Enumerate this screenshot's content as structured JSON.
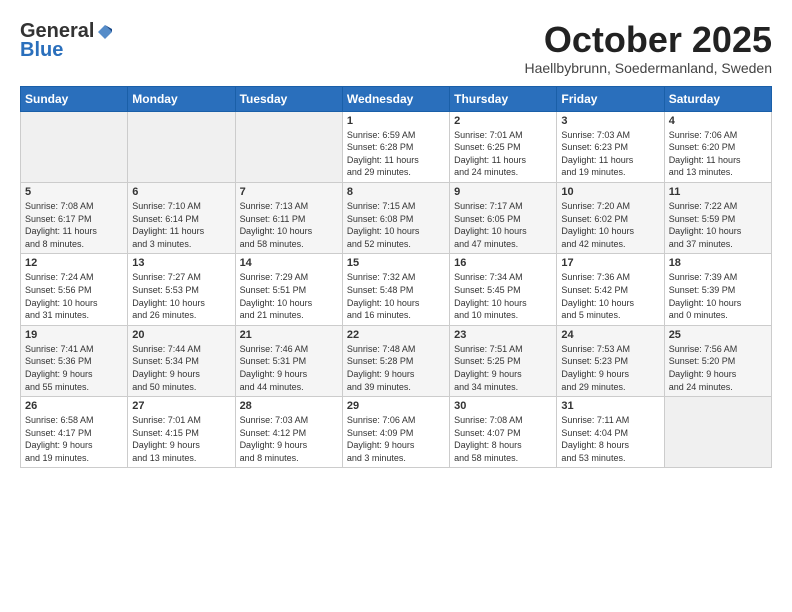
{
  "header": {
    "logo_line1": "General",
    "logo_line2": "Blue",
    "month": "October 2025",
    "location": "Haellbybrunn, Soedermanland, Sweden"
  },
  "days_of_week": [
    "Sunday",
    "Monday",
    "Tuesday",
    "Wednesday",
    "Thursday",
    "Friday",
    "Saturday"
  ],
  "weeks": [
    [
      {
        "day": "",
        "info": ""
      },
      {
        "day": "",
        "info": ""
      },
      {
        "day": "",
        "info": ""
      },
      {
        "day": "1",
        "info": "Sunrise: 6:59 AM\nSunset: 6:28 PM\nDaylight: 11 hours\nand 29 minutes."
      },
      {
        "day": "2",
        "info": "Sunrise: 7:01 AM\nSunset: 6:25 PM\nDaylight: 11 hours\nand 24 minutes."
      },
      {
        "day": "3",
        "info": "Sunrise: 7:03 AM\nSunset: 6:23 PM\nDaylight: 11 hours\nand 19 minutes."
      },
      {
        "day": "4",
        "info": "Sunrise: 7:06 AM\nSunset: 6:20 PM\nDaylight: 11 hours\nand 13 minutes."
      }
    ],
    [
      {
        "day": "5",
        "info": "Sunrise: 7:08 AM\nSunset: 6:17 PM\nDaylight: 11 hours\nand 8 minutes."
      },
      {
        "day": "6",
        "info": "Sunrise: 7:10 AM\nSunset: 6:14 PM\nDaylight: 11 hours\nand 3 minutes."
      },
      {
        "day": "7",
        "info": "Sunrise: 7:13 AM\nSunset: 6:11 PM\nDaylight: 10 hours\nand 58 minutes."
      },
      {
        "day": "8",
        "info": "Sunrise: 7:15 AM\nSunset: 6:08 PM\nDaylight: 10 hours\nand 52 minutes."
      },
      {
        "day": "9",
        "info": "Sunrise: 7:17 AM\nSunset: 6:05 PM\nDaylight: 10 hours\nand 47 minutes."
      },
      {
        "day": "10",
        "info": "Sunrise: 7:20 AM\nSunset: 6:02 PM\nDaylight: 10 hours\nand 42 minutes."
      },
      {
        "day": "11",
        "info": "Sunrise: 7:22 AM\nSunset: 5:59 PM\nDaylight: 10 hours\nand 37 minutes."
      }
    ],
    [
      {
        "day": "12",
        "info": "Sunrise: 7:24 AM\nSunset: 5:56 PM\nDaylight: 10 hours\nand 31 minutes."
      },
      {
        "day": "13",
        "info": "Sunrise: 7:27 AM\nSunset: 5:53 PM\nDaylight: 10 hours\nand 26 minutes."
      },
      {
        "day": "14",
        "info": "Sunrise: 7:29 AM\nSunset: 5:51 PM\nDaylight: 10 hours\nand 21 minutes."
      },
      {
        "day": "15",
        "info": "Sunrise: 7:32 AM\nSunset: 5:48 PM\nDaylight: 10 hours\nand 16 minutes."
      },
      {
        "day": "16",
        "info": "Sunrise: 7:34 AM\nSunset: 5:45 PM\nDaylight: 10 hours\nand 10 minutes."
      },
      {
        "day": "17",
        "info": "Sunrise: 7:36 AM\nSunset: 5:42 PM\nDaylight: 10 hours\nand 5 minutes."
      },
      {
        "day": "18",
        "info": "Sunrise: 7:39 AM\nSunset: 5:39 PM\nDaylight: 10 hours\nand 0 minutes."
      }
    ],
    [
      {
        "day": "19",
        "info": "Sunrise: 7:41 AM\nSunset: 5:36 PM\nDaylight: 9 hours\nand 55 minutes."
      },
      {
        "day": "20",
        "info": "Sunrise: 7:44 AM\nSunset: 5:34 PM\nDaylight: 9 hours\nand 50 minutes."
      },
      {
        "day": "21",
        "info": "Sunrise: 7:46 AM\nSunset: 5:31 PM\nDaylight: 9 hours\nand 44 minutes."
      },
      {
        "day": "22",
        "info": "Sunrise: 7:48 AM\nSunset: 5:28 PM\nDaylight: 9 hours\nand 39 minutes."
      },
      {
        "day": "23",
        "info": "Sunrise: 7:51 AM\nSunset: 5:25 PM\nDaylight: 9 hours\nand 34 minutes."
      },
      {
        "day": "24",
        "info": "Sunrise: 7:53 AM\nSunset: 5:23 PM\nDaylight: 9 hours\nand 29 minutes."
      },
      {
        "day": "25",
        "info": "Sunrise: 7:56 AM\nSunset: 5:20 PM\nDaylight: 9 hours\nand 24 minutes."
      }
    ],
    [
      {
        "day": "26",
        "info": "Sunrise: 6:58 AM\nSunset: 4:17 PM\nDaylight: 9 hours\nand 19 minutes."
      },
      {
        "day": "27",
        "info": "Sunrise: 7:01 AM\nSunset: 4:15 PM\nDaylight: 9 hours\nand 13 minutes."
      },
      {
        "day": "28",
        "info": "Sunrise: 7:03 AM\nSunset: 4:12 PM\nDaylight: 9 hours\nand 8 minutes."
      },
      {
        "day": "29",
        "info": "Sunrise: 7:06 AM\nSunset: 4:09 PM\nDaylight: 9 hours\nand 3 minutes."
      },
      {
        "day": "30",
        "info": "Sunrise: 7:08 AM\nSunset: 4:07 PM\nDaylight: 8 hours\nand 58 minutes."
      },
      {
        "day": "31",
        "info": "Sunrise: 7:11 AM\nSunset: 4:04 PM\nDaylight: 8 hours\nand 53 minutes."
      },
      {
        "day": "",
        "info": ""
      }
    ]
  ]
}
